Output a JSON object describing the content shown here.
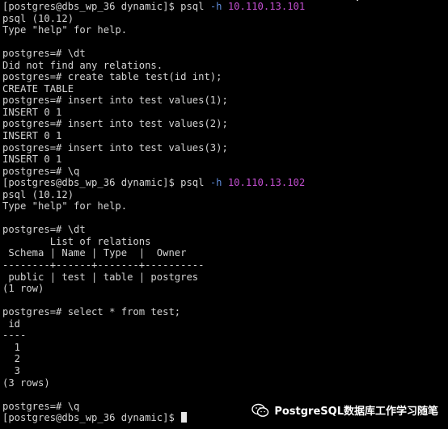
{
  "terminal": {
    "lines": [
      {
        "segments": [
          {
            "text": "[postgres@dbs_wp_36 dynamic]$ psql "
          },
          {
            "text": "-h",
            "cls": "opt"
          },
          {
            "text": " "
          },
          {
            "text": "10.110.13.101",
            "cls": "ip"
          }
        ]
      },
      {
        "segments": [
          {
            "text": "psql (10.12)"
          }
        ]
      },
      {
        "segments": [
          {
            "text": "Type \"help\" for help."
          }
        ]
      },
      {
        "segments": [
          {
            "text": ""
          }
        ]
      },
      {
        "segments": [
          {
            "text": "postgres=# \\dt"
          }
        ]
      },
      {
        "segments": [
          {
            "text": "Did not find any relations."
          }
        ]
      },
      {
        "segments": [
          {
            "text": "postgres=# create table test(id int);"
          }
        ]
      },
      {
        "segments": [
          {
            "text": "CREATE TABLE"
          }
        ]
      },
      {
        "segments": [
          {
            "text": "postgres=# insert into test values(1);"
          }
        ]
      },
      {
        "segments": [
          {
            "text": "INSERT 0 1"
          }
        ]
      },
      {
        "segments": [
          {
            "text": "postgres=# insert into test values(2);"
          }
        ]
      },
      {
        "segments": [
          {
            "text": "INSERT 0 1"
          }
        ]
      },
      {
        "segments": [
          {
            "text": "postgres=# insert into test values(3);"
          }
        ]
      },
      {
        "segments": [
          {
            "text": "INSERT 0 1"
          }
        ]
      },
      {
        "segments": [
          {
            "text": "postgres=# \\q"
          }
        ]
      },
      {
        "segments": [
          {
            "text": "[postgres@dbs_wp_36 dynamic]$ psql "
          },
          {
            "text": "-h",
            "cls": "opt"
          },
          {
            "text": " "
          },
          {
            "text": "10.110.13.102",
            "cls": "ip"
          }
        ]
      },
      {
        "segments": [
          {
            "text": "psql (10.12)"
          }
        ]
      },
      {
        "segments": [
          {
            "text": "Type \"help\" for help."
          }
        ]
      },
      {
        "segments": [
          {
            "text": ""
          }
        ]
      },
      {
        "segments": [
          {
            "text": "postgres=# \\dt"
          }
        ]
      },
      {
        "segments": [
          {
            "text": "        List of relations"
          }
        ]
      },
      {
        "segments": [
          {
            "text": " Schema | Name | Type  |  Owner"
          }
        ]
      },
      {
        "segments": [
          {
            "text": "--------+------+-------+----------"
          }
        ]
      },
      {
        "segments": [
          {
            "text": " public | test | table | postgres"
          }
        ]
      },
      {
        "segments": [
          {
            "text": "(1 row)"
          }
        ]
      },
      {
        "segments": [
          {
            "text": ""
          }
        ]
      },
      {
        "segments": [
          {
            "text": "postgres=# select * from test;"
          }
        ]
      },
      {
        "segments": [
          {
            "text": " id"
          }
        ]
      },
      {
        "segments": [
          {
            "text": "----"
          }
        ]
      },
      {
        "segments": [
          {
            "text": "  1"
          }
        ]
      },
      {
        "segments": [
          {
            "text": "  2"
          }
        ]
      },
      {
        "segments": [
          {
            "text": "  3"
          }
        ]
      },
      {
        "segments": [
          {
            "text": "(3 rows)"
          }
        ]
      },
      {
        "segments": [
          {
            "text": ""
          }
        ]
      },
      {
        "segments": [
          {
            "text": "postgres=# \\q"
          }
        ]
      },
      {
        "segments": [
          {
            "text": "[postgres@dbs_wp_36 dynamic]$ "
          }
        ],
        "cursor": true
      }
    ]
  },
  "watermark": {
    "text": "PostgreSQL数据库工作学习随笔",
    "icon": "wechat-icon"
  }
}
